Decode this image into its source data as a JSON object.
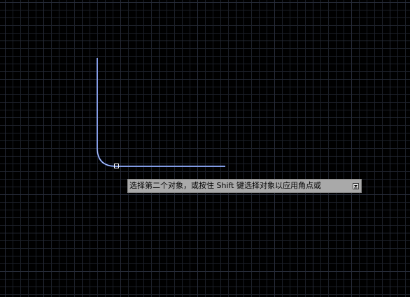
{
  "canvas": {
    "background_color": "#000000",
    "grid_minor_color": "#1c2029",
    "grid_major_color": "#262b38"
  },
  "drawing": {
    "line_color": "#4a6fd8",
    "selected_highlight_color": "#dfe7ff",
    "grip_color": "#ffffff"
  },
  "command_prompt": {
    "text": "选择第二个对象，或按住 Shift 键选择对象以应用角点或",
    "dropdown_icon": "arrow-down-icon"
  }
}
